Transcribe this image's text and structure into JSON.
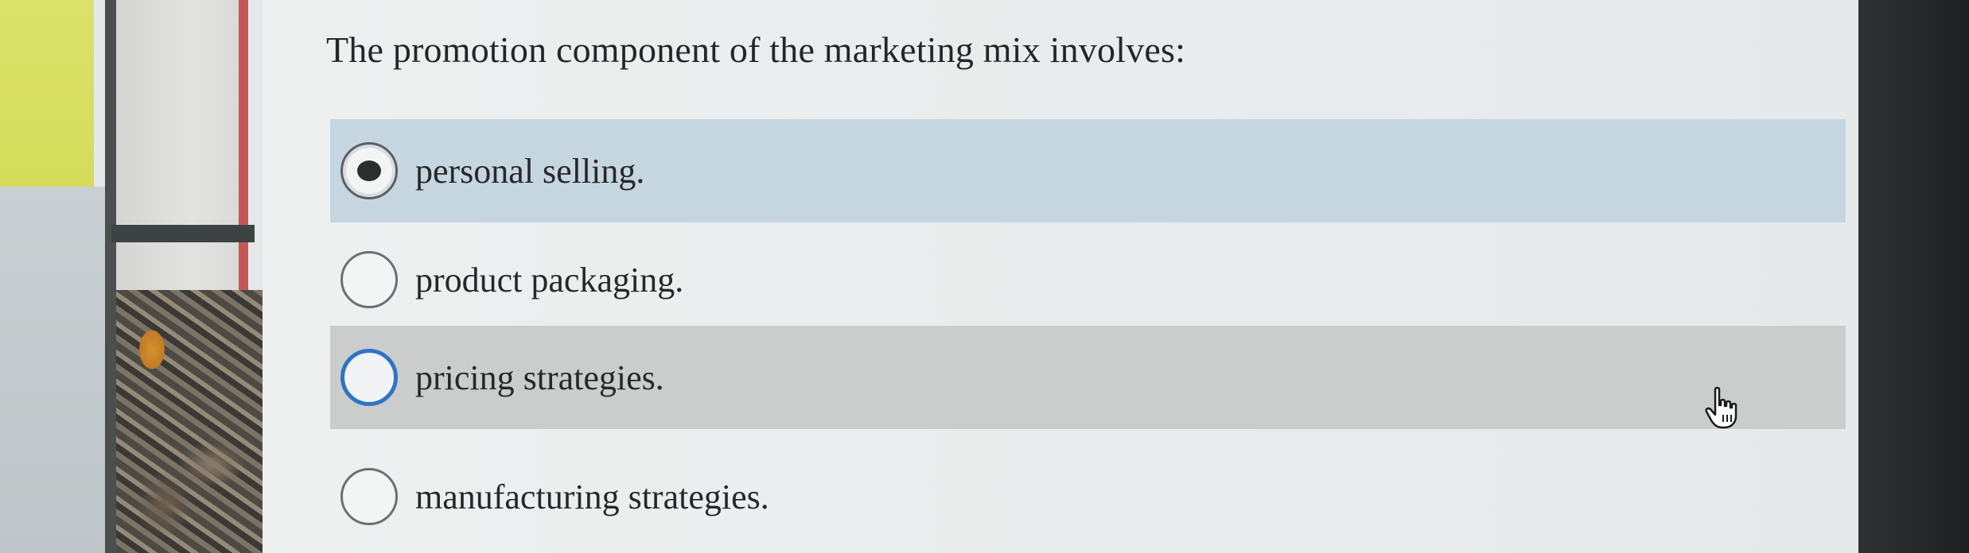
{
  "question": {
    "text": "The promotion component of the marketing mix involves:"
  },
  "options": [
    {
      "label": "personal selling.",
      "state": "selected"
    },
    {
      "label": "product packaging.",
      "state": "unselected"
    },
    {
      "label": "pricing strategies.",
      "state": "focused"
    },
    {
      "label": "manufacturing strategies.",
      "state": "unselected"
    }
  ],
  "colors": {
    "selected_row": "#c6d6e0",
    "hover_row": "#cbcdcd",
    "focus_ring": "#2e74c4"
  },
  "icons": {
    "cursor": "hand-pointer-icon"
  }
}
